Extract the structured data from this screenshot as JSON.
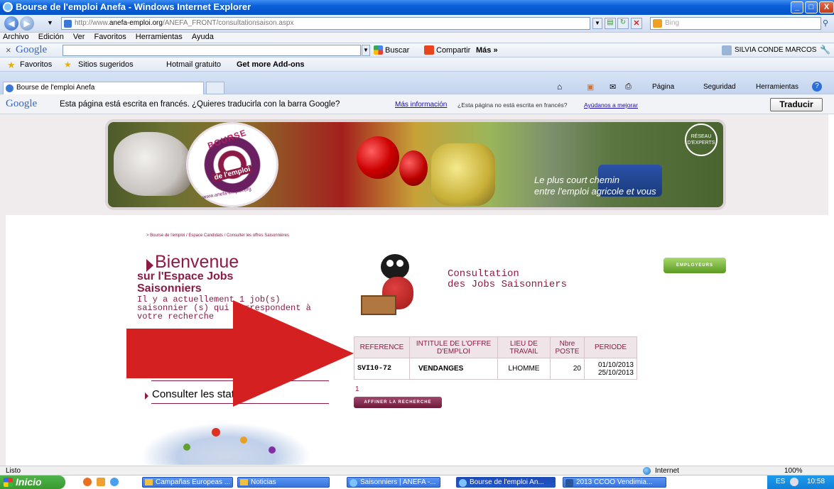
{
  "window": {
    "title": "Bourse de l'emploi Anefa - Windows Internet Explorer",
    "min": "_",
    "max": "□",
    "close": "X"
  },
  "address": {
    "url_prefix": "http://www.",
    "url_domain": "anefa-emploi.org",
    "url_path": "/ANEFA_FRONT/consultationsaison.aspx",
    "search_placeholder": "Bing"
  },
  "menu": [
    "Archivo",
    "Edición",
    "Ver",
    "Favoritos",
    "Herramientas",
    "Ayuda"
  ],
  "google_toolbar": {
    "close": "×",
    "logo": "Google",
    "buscar": "Buscar",
    "compartir": "Compartir",
    "mas": "Más »",
    "user": "SILVIA CONDE MARCOS"
  },
  "favorites_bar": {
    "favoritos": "Favoritos",
    "items": [
      "Sitios sugeridos",
      "Hotmail gratuito",
      "Get more Add-ons"
    ]
  },
  "tab": {
    "label": "Bourse de l'emploi Anefa"
  },
  "command_bar": [
    "Página",
    "Seguridad",
    "Herramientas"
  ],
  "translate_bar": {
    "logo": "Google",
    "message": "Esta página está escrita en francés. ¿Quieres traducirla con la barra Google?",
    "more_info": "Más información",
    "not_french": "¿Esta página no está escrita en francés?",
    "help": "Ayúdanos a mejorar",
    "button": "Traducir"
  },
  "banner": {
    "logo_top": "BOURSE",
    "logo_mid": "de l'emploi",
    "logo_url": "www.anefa-emploi.org",
    "badge": "RÉSEAU D'EXPERTS",
    "slogan_line1": "Le plus court chemin",
    "slogan_line2": "entre l'emploi agricole et vous"
  },
  "breadcrumb": "> Bourse de l'emploi / Espace Candidats / Consulter les offres Saisonnières",
  "welcome": {
    "bienvenue": "Bienvenue",
    "heading": "sur l'Espace Jobs Saisonniers",
    "count_text": "Il y a actuellement 1 job(s) saisonnier (s) qui correspondent à votre recherche"
  },
  "employers_button": "EMPLOYEURS",
  "consultation_title_1": "Consultation",
  "consultation_title_2": "des Jobs Saisonniers",
  "table": {
    "headers": [
      "REFERENCE",
      "INTITULE DE L'OFFRE D'EMPLOI",
      "LIEU DE TRAVAIL",
      "Nbre POSTE",
      "PERIODE"
    ],
    "rows": [
      {
        "ref": "SVI10-72",
        "title": "VENDANGES",
        "place": "LHOMME",
        "count": "20",
        "period_start": "01/10/2013",
        "period_end": "25/10/2013"
      }
    ]
  },
  "pagination": "1",
  "refine_button": "AFFINER LA RECHERCHE",
  "left_links": {
    "stats": "Consulter les stats"
  },
  "status_bar": {
    "left": "Listo",
    "zone": "Internet",
    "zoom": "100%"
  },
  "taskbar": {
    "start": "Inicio",
    "items": [
      "Campañas Europeas ...",
      "Noticias",
      "Saisonniers | ANEFA -...",
      "Bourse de l'emploi An...",
      "2013 CCOO Vendimia..."
    ],
    "lang": "ES",
    "time": "10:58"
  },
  "colors": {
    "accent": "#8b1a45",
    "arrow": "#d42020",
    "titlebar": "#0a5fd8"
  }
}
